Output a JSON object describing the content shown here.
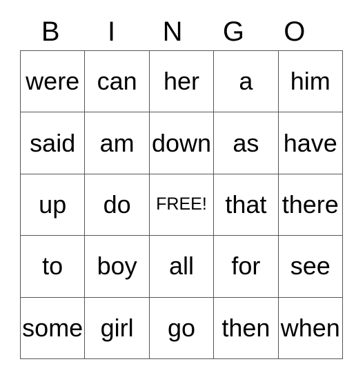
{
  "card": {
    "header_letters": [
      "B",
      "I",
      "N",
      "G",
      "O"
    ],
    "rows": [
      [
        "were",
        "can",
        "her",
        "a",
        "him"
      ],
      [
        "said",
        "am",
        "down",
        "as",
        "have"
      ],
      [
        "up",
        "do",
        "FREE!",
        "that",
        "there"
      ],
      [
        "to",
        "boy",
        "all",
        "for",
        "see"
      ],
      [
        "some",
        "girl",
        "go",
        "then",
        "when"
      ]
    ],
    "free_space": {
      "row": 2,
      "column": 2,
      "label": "FREE!"
    },
    "colors": {
      "background": "#ffffff",
      "text": "#000000",
      "grid_line": "#555555"
    }
  }
}
